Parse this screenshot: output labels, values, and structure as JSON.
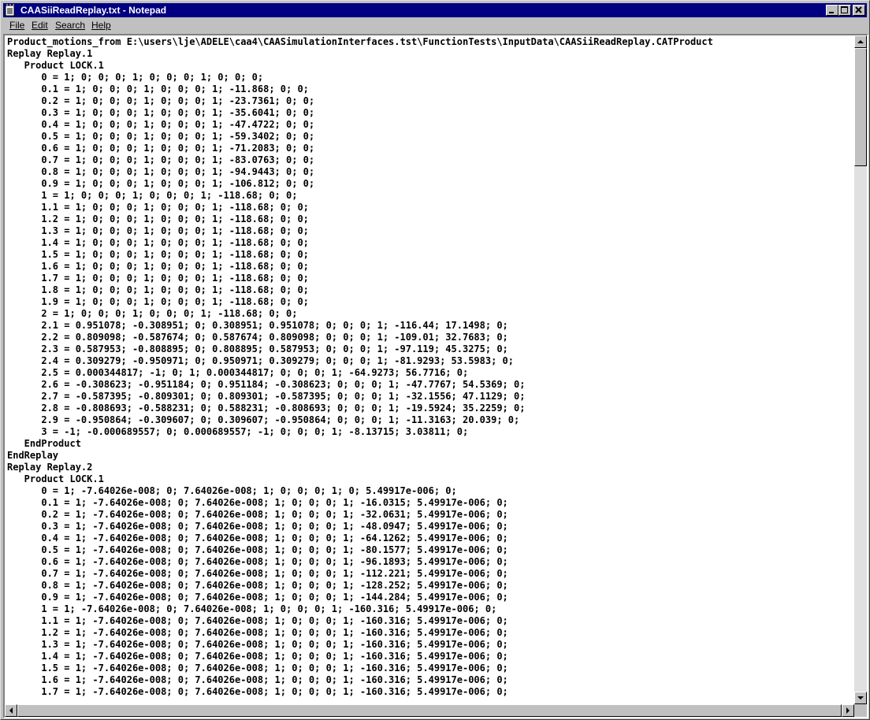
{
  "window": {
    "title": "CAASiiReadReplay.txt - Notepad",
    "title_bar_color": "#000080"
  },
  "menu": {
    "file": "File",
    "edit": "Edit",
    "search": "Search",
    "help": "Help"
  },
  "document": {
    "lines": [
      "Product_motions_from E:\\users\\lje\\ADELE\\caa4\\CAASimulationInterfaces.tst\\FunctionTests\\InputData\\CAASiiReadReplay.CATProduct",
      "Replay Replay.1",
      "   Product LOCK.1",
      "      0 = 1; 0; 0; 0; 1; 0; 0; 0; 1; 0; 0; 0;",
      "      0.1 = 1; 0; 0; 0; 1; 0; 0; 0; 1; -11.868; 0; 0;",
      "      0.2 = 1; 0; 0; 0; 1; 0; 0; 0; 1; -23.7361; 0; 0;",
      "      0.3 = 1; 0; 0; 0; 1; 0; 0; 0; 1; -35.6041; 0; 0;",
      "      0.4 = 1; 0; 0; 0; 1; 0; 0; 0; 1; -47.4722; 0; 0;",
      "      0.5 = 1; 0; 0; 0; 1; 0; 0; 0; 1; -59.3402; 0; 0;",
      "      0.6 = 1; 0; 0; 0; 1; 0; 0; 0; 1; -71.2083; 0; 0;",
      "      0.7 = 1; 0; 0; 0; 1; 0; 0; 0; 1; -83.0763; 0; 0;",
      "      0.8 = 1; 0; 0; 0; 1; 0; 0; 0; 1; -94.9443; 0; 0;",
      "      0.9 = 1; 0; 0; 0; 1; 0; 0; 0; 1; -106.812; 0; 0;",
      "      1 = 1; 0; 0; 0; 1; 0; 0; 0; 1; -118.68; 0; 0;",
      "      1.1 = 1; 0; 0; 0; 1; 0; 0; 0; 1; -118.68; 0; 0;",
      "      1.2 = 1; 0; 0; 0; 1; 0; 0; 0; 1; -118.68; 0; 0;",
      "      1.3 = 1; 0; 0; 0; 1; 0; 0; 0; 1; -118.68; 0; 0;",
      "      1.4 = 1; 0; 0; 0; 1; 0; 0; 0; 1; -118.68; 0; 0;",
      "      1.5 = 1; 0; 0; 0; 1; 0; 0; 0; 1; -118.68; 0; 0;",
      "      1.6 = 1; 0; 0; 0; 1; 0; 0; 0; 1; -118.68; 0; 0;",
      "      1.7 = 1; 0; 0; 0; 1; 0; 0; 0; 1; -118.68; 0; 0;",
      "      1.8 = 1; 0; 0; 0; 1; 0; 0; 0; 1; -118.68; 0; 0;",
      "      1.9 = 1; 0; 0; 0; 1; 0; 0; 0; 1; -118.68; 0; 0;",
      "      2 = 1; 0; 0; 0; 1; 0; 0; 0; 1; -118.68; 0; 0;",
      "      2.1 = 0.951078; -0.308951; 0; 0.308951; 0.951078; 0; 0; 0; 1; -116.44; 17.1498; 0;",
      "      2.2 = 0.809098; -0.587674; 0; 0.587674; 0.809098; 0; 0; 0; 1; -109.01; 32.7683; 0;",
      "      2.3 = 0.587953; -0.808895; 0; 0.808895; 0.587953; 0; 0; 0; 1; -97.119; 45.3275; 0;",
      "      2.4 = 0.309279; -0.950971; 0; 0.950971; 0.309279; 0; 0; 0; 1; -81.9293; 53.5983; 0;",
      "      2.5 = 0.000344817; -1; 0; 1; 0.000344817; 0; 0; 0; 1; -64.9273; 56.7716; 0;",
      "      2.6 = -0.308623; -0.951184; 0; 0.951184; -0.308623; 0; 0; 0; 1; -47.7767; 54.5369; 0;",
      "      2.7 = -0.587395; -0.809301; 0; 0.809301; -0.587395; 0; 0; 0; 1; -32.1556; 47.1129; 0;",
      "      2.8 = -0.808693; -0.588231; 0; 0.588231; -0.808693; 0; 0; 0; 1; -19.5924; 35.2259; 0;",
      "      2.9 = -0.950864; -0.309607; 0; 0.309607; -0.950864; 0; 0; 0; 1; -11.3163; 20.039; 0;",
      "      3 = -1; -0.000689557; 0; 0.000689557; -1; 0; 0; 0; 1; -8.13715; 3.03811; 0;",
      "   EndProduct",
      "EndReplay",
      "Replay Replay.2",
      "   Product LOCK.1",
      "      0 = 1; -7.64026e-008; 0; 7.64026e-008; 1; 0; 0; 0; 1; 0; 5.49917e-006; 0;",
      "      0.1 = 1; -7.64026e-008; 0; 7.64026e-008; 1; 0; 0; 0; 1; -16.0315; 5.49917e-006; 0;",
      "      0.2 = 1; -7.64026e-008; 0; 7.64026e-008; 1; 0; 0; 0; 1; -32.0631; 5.49917e-006; 0;",
      "      0.3 = 1; -7.64026e-008; 0; 7.64026e-008; 1; 0; 0; 0; 1; -48.0947; 5.49917e-006; 0;",
      "      0.4 = 1; -7.64026e-008; 0; 7.64026e-008; 1; 0; 0; 0; 1; -64.1262; 5.49917e-006; 0;",
      "      0.5 = 1; -7.64026e-008; 0; 7.64026e-008; 1; 0; 0; 0; 1; -80.1577; 5.49917e-006; 0;",
      "      0.6 = 1; -7.64026e-008; 0; 7.64026e-008; 1; 0; 0; 0; 1; -96.1893; 5.49917e-006; 0;",
      "      0.7 = 1; -7.64026e-008; 0; 7.64026e-008; 1; 0; 0; 0; 1; -112.221; 5.49917e-006; 0;",
      "      0.8 = 1; -7.64026e-008; 0; 7.64026e-008; 1; 0; 0; 0; 1; -128.252; 5.49917e-006; 0;",
      "      0.9 = 1; -7.64026e-008; 0; 7.64026e-008; 1; 0; 0; 0; 1; -144.284; 5.49917e-006; 0;",
      "      1 = 1; -7.64026e-008; 0; 7.64026e-008; 1; 0; 0; 0; 1; -160.316; 5.49917e-006; 0;",
      "      1.1 = 1; -7.64026e-008; 0; 7.64026e-008; 1; 0; 0; 0; 1; -160.316; 5.49917e-006; 0;",
      "      1.2 = 1; -7.64026e-008; 0; 7.64026e-008; 1; 0; 0; 0; 1; -160.316; 5.49917e-006; 0;",
      "      1.3 = 1; -7.64026e-008; 0; 7.64026e-008; 1; 0; 0; 0; 1; -160.316; 5.49917e-006; 0;",
      "      1.4 = 1; -7.64026e-008; 0; 7.64026e-008; 1; 0; 0; 0; 1; -160.316; 5.49917e-006; 0;",
      "      1.5 = 1; -7.64026e-008; 0; 7.64026e-008; 1; 0; 0; 0; 1; -160.316; 5.49917e-006; 0;",
      "      1.6 = 1; -7.64026e-008; 0; 7.64026e-008; 1; 0; 0; 0; 1; -160.316; 5.49917e-006; 0;",
      "      1.7 = 1; -7.64026e-008; 0; 7.64026e-008; 1; 0; 0; 0; 1; -160.316; 5.49917e-006; 0;"
    ]
  },
  "scrollbars": {
    "vertical_position": 0,
    "horizontal_position": 0
  }
}
